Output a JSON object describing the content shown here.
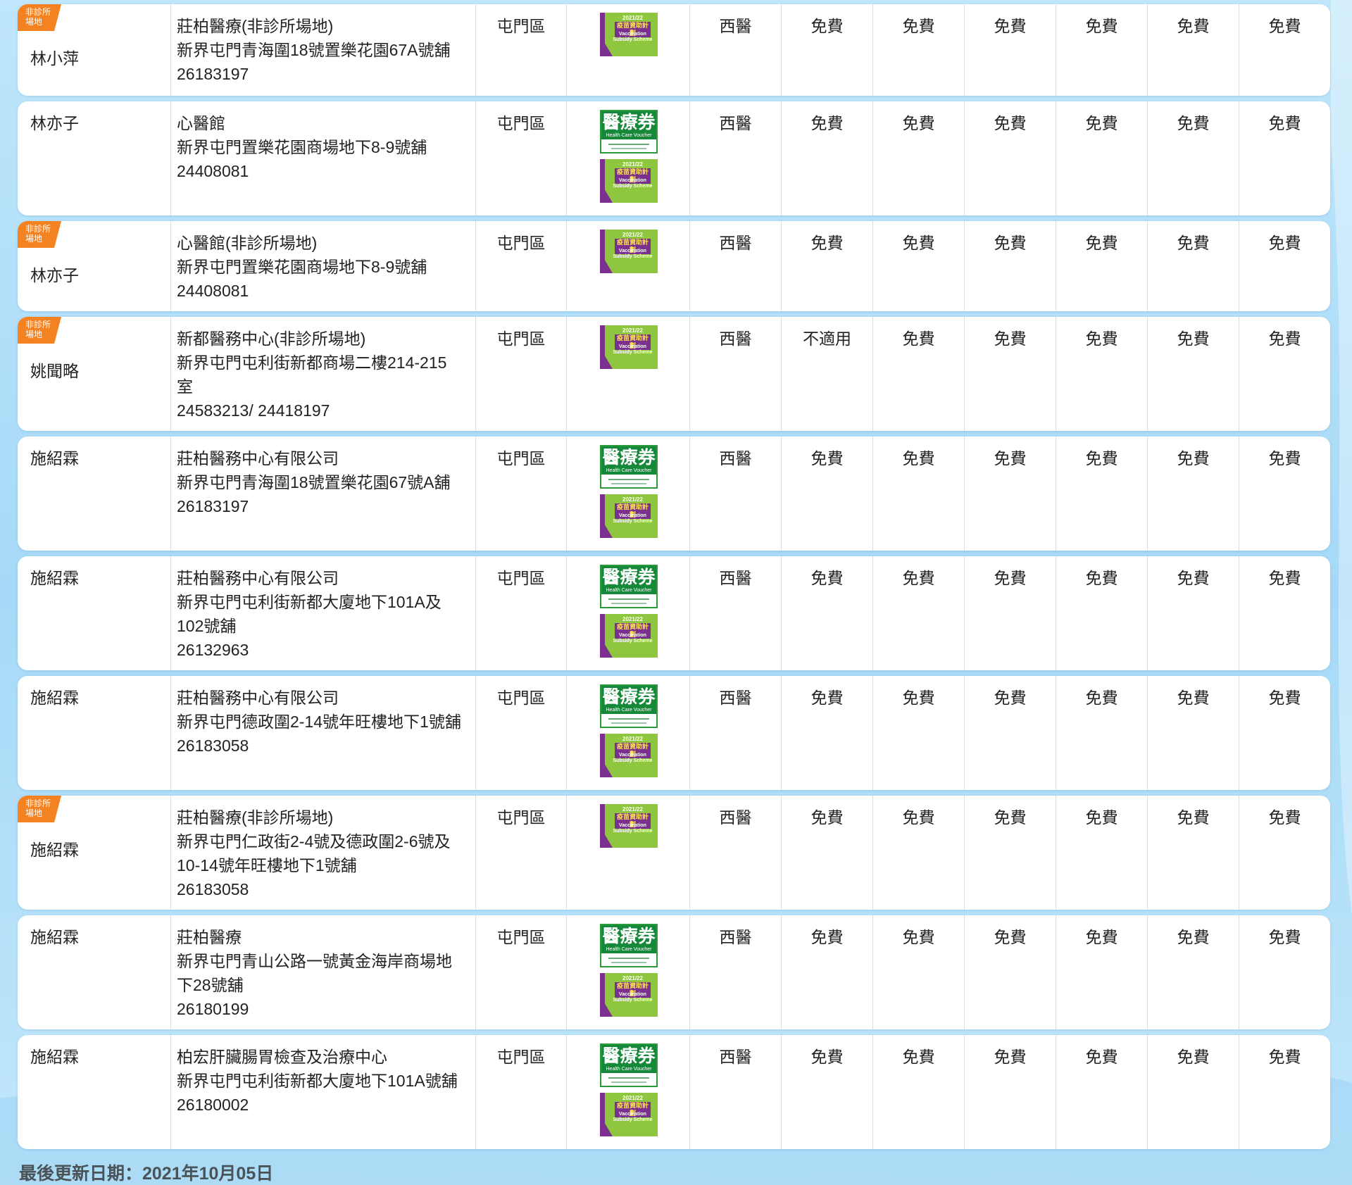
{
  "badge_text": "非診所\n場地",
  "logos": {
    "vaccination": {
      "line1": "2021/22",
      "line2": "疫苗資助計劃",
      "line3": "Vaccination Subsidy Scheme"
    },
    "voucher": {
      "title": "醫療券",
      "sub": "Health Care Voucher"
    }
  },
  "rows": [
    {
      "doctor": "林小萍",
      "badge": true,
      "clinic": [
        "莊柏醫療(非診所場地)",
        "新界屯門青海圍18號置樂花園67A號舖",
        "26183197"
      ],
      "district": "屯門區",
      "voucher": false,
      "vaccine": true,
      "type": "西醫",
      "fees": [
        "免費",
        "免費",
        "免費",
        "免費",
        "免費",
        "免費"
      ]
    },
    {
      "doctor": "林亦子",
      "badge": false,
      "clinic": [
        "心醫館",
        "新界屯門置樂花園商場地下8-9號舖",
        "24408081"
      ],
      "district": "屯門區",
      "voucher": true,
      "vaccine": true,
      "type": "西醫",
      "fees": [
        "免費",
        "免費",
        "免費",
        "免費",
        "免費",
        "免費"
      ]
    },
    {
      "doctor": "林亦子",
      "badge": true,
      "clinic": [
        "心醫館(非診所場地)",
        "新界屯門置樂花園商場地下8-9號舖",
        "24408081"
      ],
      "district": "屯門區",
      "voucher": false,
      "vaccine": true,
      "type": "西醫",
      "fees": [
        "免費",
        "免費",
        "免費",
        "免費",
        "免費",
        "免費"
      ]
    },
    {
      "doctor": "姚聞略",
      "badge": true,
      "clinic": [
        "新都醫務中心(非診所場地)",
        "新界屯門屯利街新都商場二樓214-215",
        "室",
        "24583213/ 24418197"
      ],
      "district": "屯門區",
      "voucher": false,
      "vaccine": true,
      "type": "西醫",
      "fees": [
        "不適用",
        "免費",
        "免費",
        "免費",
        "免費",
        "免費"
      ]
    },
    {
      "doctor": "施紹霖",
      "badge": false,
      "clinic": [
        "莊柏醫務中心有限公司",
        "新界屯門青海圍18號置樂花園67號A舖",
        "26183197"
      ],
      "district": "屯門區",
      "voucher": true,
      "vaccine": true,
      "type": "西醫",
      "fees": [
        "免費",
        "免費",
        "免費",
        "免費",
        "免費",
        "免費"
      ]
    },
    {
      "doctor": "施紹霖",
      "badge": false,
      "clinic": [
        "莊柏醫務中心有限公司",
        "新界屯門屯利街新都大廈地下101A及",
        "102號舖",
        "26132963"
      ],
      "district": "屯門區",
      "voucher": true,
      "vaccine": true,
      "type": "西醫",
      "fees": [
        "免費",
        "免費",
        "免費",
        "免費",
        "免費",
        "免費"
      ]
    },
    {
      "doctor": "施紹霖",
      "badge": false,
      "clinic": [
        "莊柏醫務中心有限公司",
        "新界屯門德政圍2-14號年旺樓地下1號舖",
        "26183058"
      ],
      "district": "屯門區",
      "voucher": true,
      "vaccine": true,
      "type": "西醫",
      "fees": [
        "免費",
        "免費",
        "免費",
        "免費",
        "免費",
        "免費"
      ]
    },
    {
      "doctor": "施紹霖",
      "badge": true,
      "clinic": [
        "莊柏醫療(非診所場地)",
        "新界屯門仁政街2-4號及德政圍2-6號及",
        "10-14號年旺樓地下1號舖",
        "26183058"
      ],
      "district": "屯門區",
      "voucher": false,
      "vaccine": true,
      "type": "西醫",
      "fees": [
        "免費",
        "免費",
        "免費",
        "免費",
        "免費",
        "免費"
      ]
    },
    {
      "doctor": "施紹霖",
      "badge": false,
      "clinic": [
        "莊柏醫療",
        "新界屯門青山公路一號黃金海岸商場地",
        "下28號舖",
        "26180199"
      ],
      "district": "屯門區",
      "voucher": true,
      "vaccine": true,
      "type": "西醫",
      "fees": [
        "免費",
        "免費",
        "免費",
        "免費",
        "免費",
        "免費"
      ]
    },
    {
      "doctor": "施紹霖",
      "badge": false,
      "clinic": [
        "柏宏肝臟腸胃檢查及治療中心",
        "新界屯門屯利街新都大廈地下101A號舖",
        "26180002"
      ],
      "district": "屯門區",
      "voucher": true,
      "vaccine": true,
      "type": "西醫",
      "fees": [
        "免費",
        "免費",
        "免費",
        "免費",
        "免費",
        "免費"
      ]
    }
  ],
  "footer": "最後更新日期：2021年10月05日"
}
